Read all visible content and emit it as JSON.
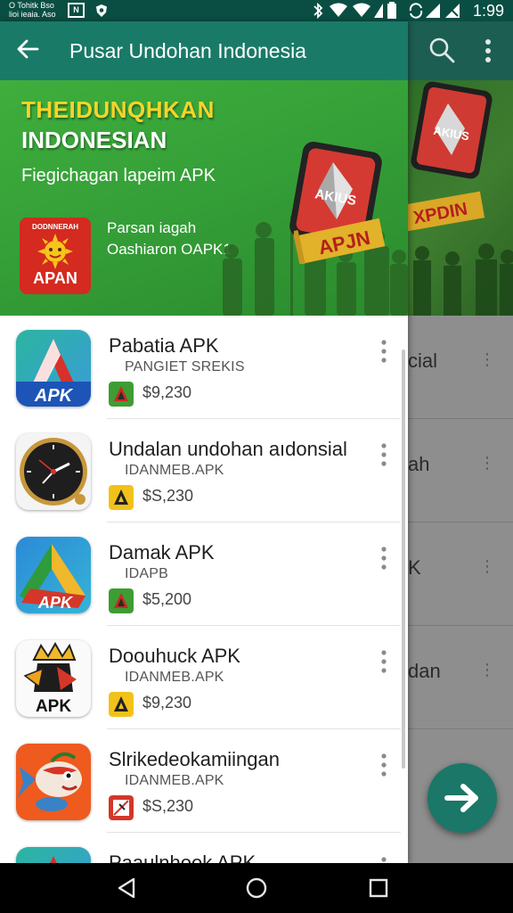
{
  "status_bar": {
    "left_line1": "O Tohitk Bso",
    "left_line2": "lioi ieaia. Aso",
    "box_label": "N",
    "time": "1:99"
  },
  "toolbar": {
    "title": "Pusar Undohan Indonesia"
  },
  "banner": {
    "headline1": "THEIDUNQHKAN",
    "headline2": "INDONESIAN",
    "subtitle": "Fiegichagan lapeim APK",
    "app_icon_top": "DODNNERAH",
    "app_icon_bottom": "APAN",
    "line1": "Parsan iagah",
    "line2": "Oashiaron OAPK1",
    "badge_text": "AKIUS",
    "ribbon_text": "APJN"
  },
  "apps": [
    {
      "name": "Pabatia APK",
      "subtitle": "PANGIET SREKIS",
      "price": "$9,230",
      "icon": "apk-a-icon",
      "icon_text": "APK"
    },
    {
      "name": "Undalan undohan aıdonsial",
      "subtitle": "IDANMEB.APK",
      "price": "$S,230",
      "icon": "clock-icon",
      "icon_text": ""
    },
    {
      "name": "Damak APK",
      "subtitle": "IDAPB",
      "price": "$5,200",
      "icon": "apk-triangle-icon",
      "icon_text": "APK"
    },
    {
      "name": "Doouhuck APK",
      "subtitle": "IDANMEB.APK",
      "price": "$9,230",
      "icon": "apk-crown-icon",
      "icon_text": "APK"
    },
    {
      "name": "Slrikedeokamiingan",
      "subtitle": "IDANMEB.APK",
      "price": "$S,230",
      "icon": "fish-icon",
      "icon_text": ""
    },
    {
      "name": "Paaulnhook APK",
      "subtitle": "",
      "price": "",
      "icon": "apk-a-icon",
      "icon_text": ""
    }
  ],
  "background_pane": {
    "banner_badge_text": "AKIUS",
    "banner_ribbon_text": "XPDIN",
    "rows": [
      "cial",
      "ah",
      "K",
      "dan"
    ]
  },
  "colors": {
    "toolbar": "#1a7a68",
    "banner_green": "#35a038",
    "headline_yellow": "#f3d52b",
    "fab": "#1b7767"
  }
}
